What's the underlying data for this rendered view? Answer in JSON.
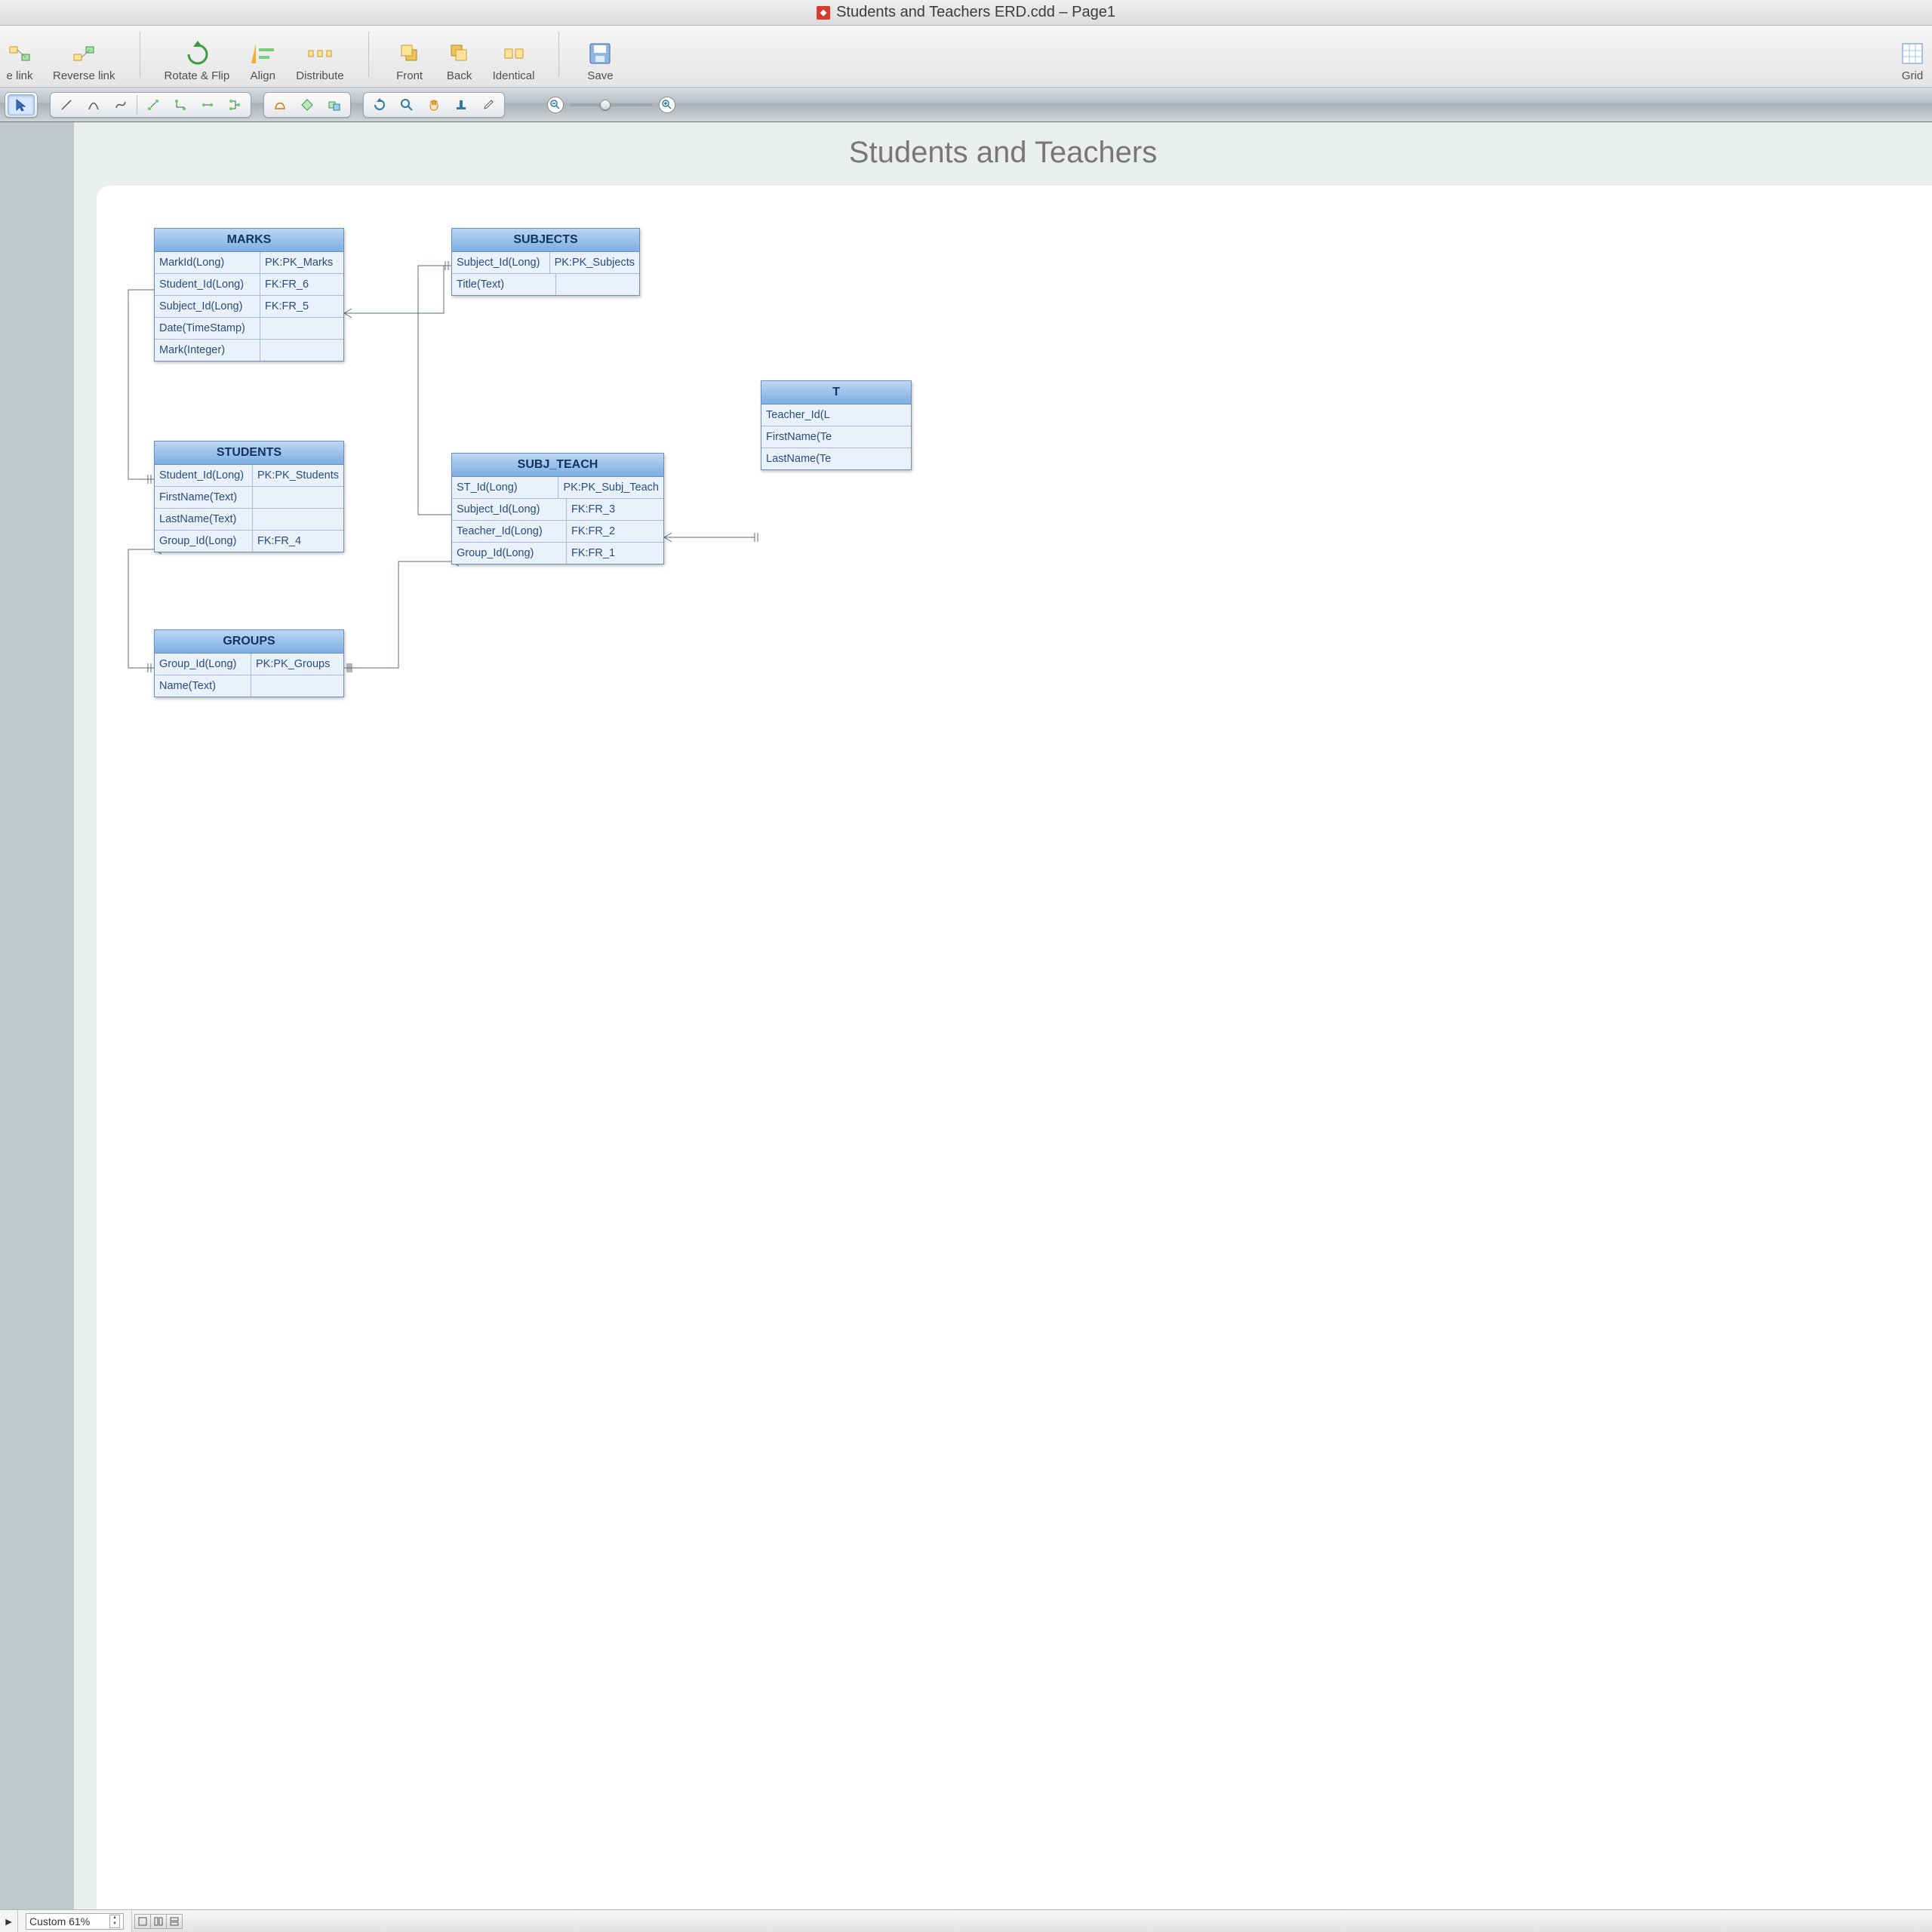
{
  "window": {
    "title": "Students and Teachers ERD.cdd – Page1"
  },
  "toolbar_upper": [
    {
      "id": "link",
      "label": "e link"
    },
    {
      "id": "reverse",
      "label": "Reverse link"
    },
    {
      "id": "rotate",
      "label": "Rotate & Flip"
    },
    {
      "id": "align",
      "label": "Align"
    },
    {
      "id": "distribute",
      "label": "Distribute"
    },
    {
      "id": "front",
      "label": "Front"
    },
    {
      "id": "back",
      "label": "Back"
    },
    {
      "id": "identical",
      "label": "Identical"
    },
    {
      "id": "save",
      "label": "Save"
    },
    {
      "id": "grid",
      "label": "Grid"
    }
  ],
  "page": {
    "title": "Students and Teachers"
  },
  "entities": {
    "marks": {
      "title": "MARKS",
      "rows": [
        {
          "col": "MarkId(Long)",
          "key": "PK:PK_Marks"
        },
        {
          "col": "Student_Id(Long)",
          "key": "FK:FR_6"
        },
        {
          "col": "Subject_Id(Long)",
          "key": "FK:FR_5"
        },
        {
          "col": "Date(TimeStamp)",
          "key": ""
        },
        {
          "col": "Mark(Integer)",
          "key": ""
        }
      ]
    },
    "subjects": {
      "title": "SUBJECTS",
      "rows": [
        {
          "col": "Subject_Id(Long)",
          "key": "PK:PK_Subjects"
        },
        {
          "col": "Title(Text)",
          "key": ""
        }
      ]
    },
    "students": {
      "title": "STUDENTS",
      "rows": [
        {
          "col": "Student_Id(Long)",
          "key": "PK:PK_Students"
        },
        {
          "col": "FirstName(Text)",
          "key": ""
        },
        {
          "col": "LastName(Text)",
          "key": ""
        },
        {
          "col": "Group_Id(Long)",
          "key": "FK:FR_4"
        }
      ]
    },
    "subjteach": {
      "title": "SUBJ_TEACH",
      "rows": [
        {
          "col": "ST_Id(Long)",
          "key": "PK:PK_Subj_Teach"
        },
        {
          "col": "Subject_Id(Long)",
          "key": "FK:FR_3"
        },
        {
          "col": "Teacher_Id(Long)",
          "key": "FK:FR_2"
        },
        {
          "col": "Group_Id(Long)",
          "key": "FK:FR_1"
        }
      ]
    },
    "groups": {
      "title": "GROUPS",
      "rows": [
        {
          "col": "Group_Id(Long)",
          "key": "PK:PK_Groups"
        },
        {
          "col": "Name(Text)",
          "key": ""
        }
      ]
    },
    "teachers": {
      "title": "T",
      "rows": [
        {
          "col": "Teacher_Id(L",
          "key": ""
        },
        {
          "col": "FirstName(Te",
          "key": ""
        },
        {
          "col": "LastName(Te",
          "key": ""
        }
      ]
    }
  },
  "status": {
    "zoom_label": "Custom 61%"
  }
}
